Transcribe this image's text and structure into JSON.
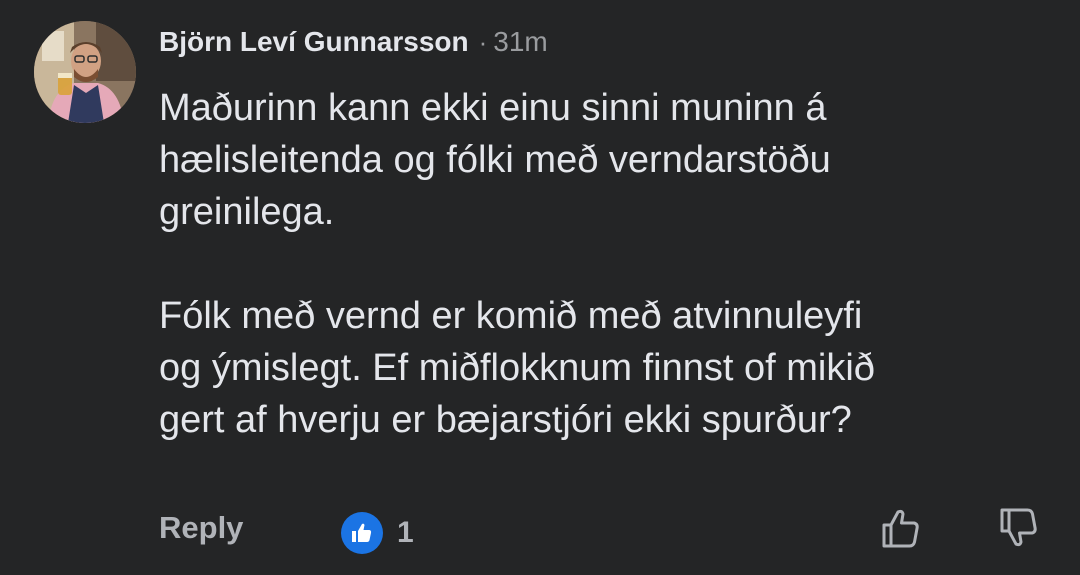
{
  "comment": {
    "author": "Björn Leví Gunnarsson",
    "separator": "·",
    "timestamp": "31m",
    "paragraphs": [
      [
        "Maðurinn kann ekki einu sinni muninn á",
        "hælisleitenda og fólki með verndarstöðu",
        "greinilega."
      ],
      [
        "Fólk með vernd er komið með atvinnuleyfi",
        "og ýmislegt. Ef miðflokknum finnst of mikið",
        "gert af hverju er bæjarstjóri ekki spurður?"
      ]
    ]
  },
  "actions": {
    "reply_label": "Reply",
    "like_count": "1",
    "like_badge_icon": "thumbs-up-icon",
    "upvote_icon": "thumbs-up-outline-icon",
    "downvote_icon": "thumbs-down-outline-icon"
  },
  "colors": {
    "background": "#242526",
    "text_primary": "#e4e6eb",
    "text_secondary": "#b0b3b8",
    "like_blue": "#1b74e4"
  }
}
